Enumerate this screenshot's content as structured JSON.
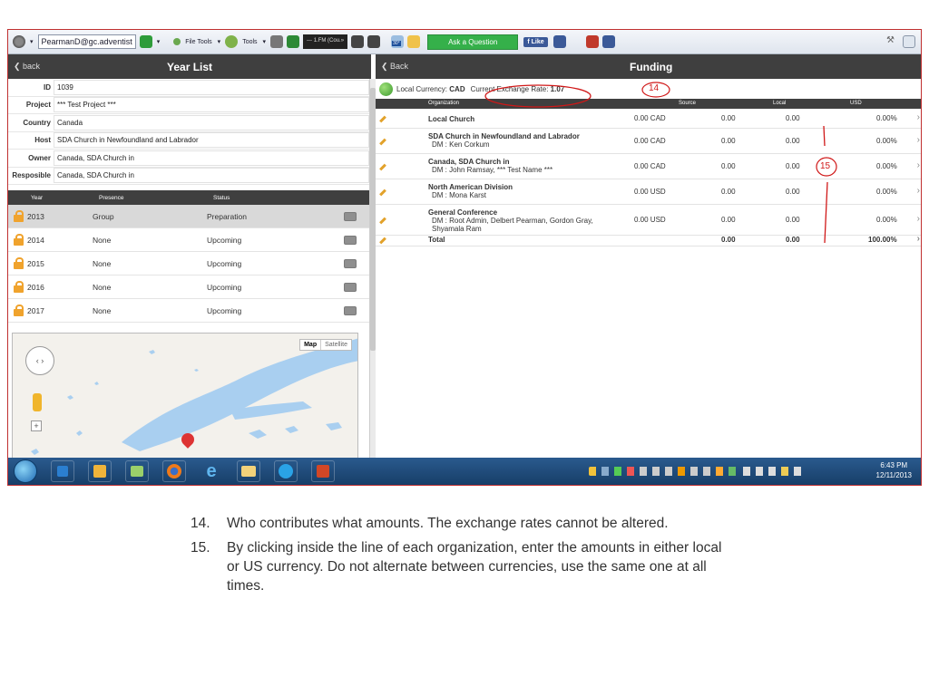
{
  "browser": {
    "account": "PearmanD@gc.adventist",
    "file_tools": "File Tools",
    "tools": "Tools",
    "media": "--- 1.FM (Cou.»",
    "weather": "30°",
    "ask": "Ask a Question",
    "like": "Like"
  },
  "left": {
    "back": "back",
    "title": "Year List",
    "fields": [
      {
        "label": "ID",
        "value": "1039"
      },
      {
        "label": "Project",
        "value": "*** Test Project ***"
      },
      {
        "label": "Country",
        "value": "Canada"
      },
      {
        "label": "Host",
        "value": "SDA Church in Newfoundland and Labrador"
      },
      {
        "label": "Owner",
        "value": "Canada, SDA Church in"
      },
      {
        "label": "Resposible",
        "value": "Canada, SDA Church in"
      }
    ],
    "year_headers": {
      "year": "Year",
      "presence": "Presence",
      "status": "Status"
    },
    "years": [
      {
        "year": "2013",
        "presence": "Group",
        "status": "Preparation"
      },
      {
        "year": "2014",
        "presence": "None",
        "status": "Upcoming"
      },
      {
        "year": "2015",
        "presence": "None",
        "status": "Upcoming"
      },
      {
        "year": "2016",
        "presence": "None",
        "status": "Upcoming"
      },
      {
        "year": "2017",
        "presence": "None",
        "status": "Upcoming"
      }
    ],
    "map": {
      "map_label": "Map",
      "satellite_label": "Satellite"
    }
  },
  "right": {
    "back": "Back",
    "title": "Funding",
    "currency_prefix": "Local Currency:",
    "currency": "CAD",
    "rate_prefix": "Current Exchange Rate:",
    "rate": "1.07",
    "headers": {
      "org": "Organization",
      "source": "Source",
      "local": "Local",
      "usd": "USD"
    },
    "rows": [
      {
        "name": "Local Church",
        "sub": "",
        "source": "0.00 CAD",
        "local": "0.00",
        "usd": "0.00",
        "pct": "0.00%"
      },
      {
        "name": "SDA Church in Newfoundland and Labrador",
        "sub": "DM : Ken Corkum",
        "source": "0.00 CAD",
        "local": "0.00",
        "usd": "0.00",
        "pct": "0.00%"
      },
      {
        "name": "Canada, SDA Church in",
        "sub": "DM : John Ramsay, *** Test Name ***",
        "source": "0.00 CAD",
        "local": "0.00",
        "usd": "0.00",
        "pct": "0.00%"
      },
      {
        "name": "North American Division",
        "sub": "DM : Mona Karst",
        "source": "0.00 USD",
        "local": "0.00",
        "usd": "0.00",
        "pct": "0.00%"
      },
      {
        "name": "General Conference",
        "sub": "DM : Root Admin, Delbert Pearman, Gordon Gray, Shyamala Ram",
        "source": "0.00 USD",
        "local": "0.00",
        "usd": "0.00",
        "pct": "0.00%"
      }
    ],
    "total": {
      "label": "Total",
      "local": "0.00",
      "usd": "0.00",
      "pct": "100.00%"
    }
  },
  "annotations": {
    "mark14": "14",
    "mark15": "15"
  },
  "taskbar": {
    "time": "6:43 PM",
    "date": "12/11/2013"
  },
  "notes": [
    {
      "num": "14.",
      "text": "Who contributes what amounts.  The exchange rates cannot be altered."
    },
    {
      "num": "15.",
      "text": "By clicking inside the line of each organization, enter the amounts in either local or US currency.  Do not alternate between currencies, use the same one at all times."
    }
  ]
}
